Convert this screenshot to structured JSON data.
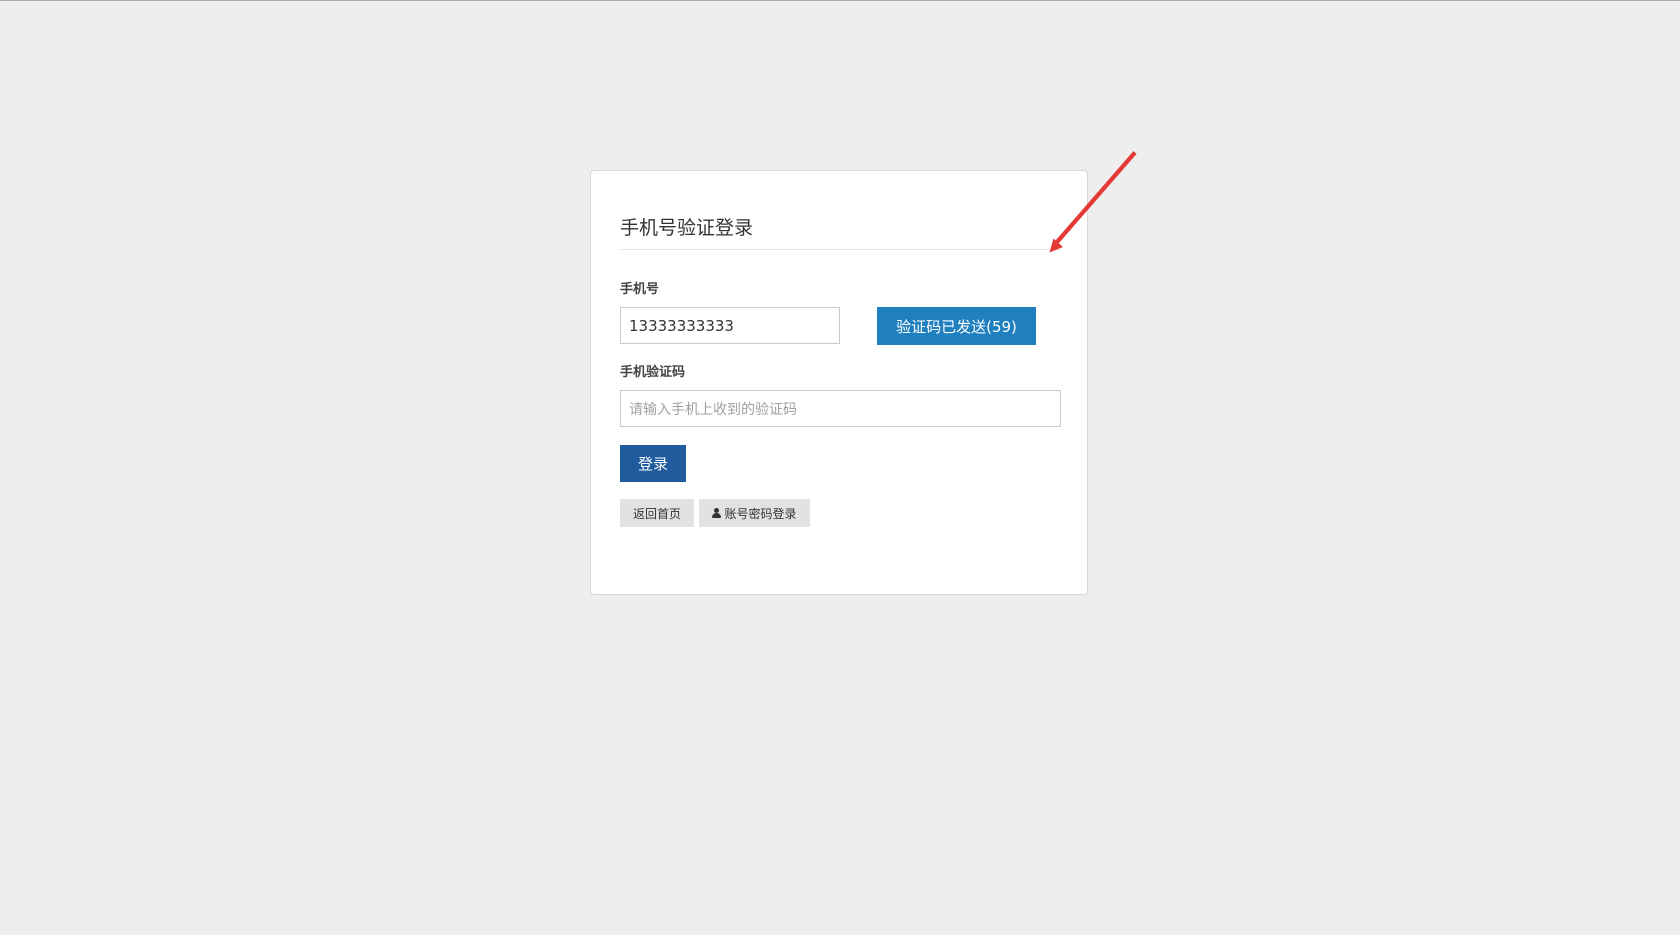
{
  "colors": {
    "page_background": "#eeeeee",
    "card_background": "#ffffff",
    "send_code_button": "#1f7fbf",
    "login_button": "#205b9e",
    "secondary_button": "#e2e2e2",
    "annotation_arrow": "#e53935"
  },
  "login_form": {
    "title": "手机号验证登录",
    "phone_label": "手机号",
    "phone_value": "13333333333",
    "send_code_label": "验证码已发送(59)",
    "code_label": "手机验证码",
    "code_placeholder": "请输入手机上收到的验证码",
    "code_value": "",
    "login_label": "登录",
    "back_home_label": "返回首页",
    "password_login_label": "账号密码登录",
    "password_login_icon": "user-icon"
  }
}
